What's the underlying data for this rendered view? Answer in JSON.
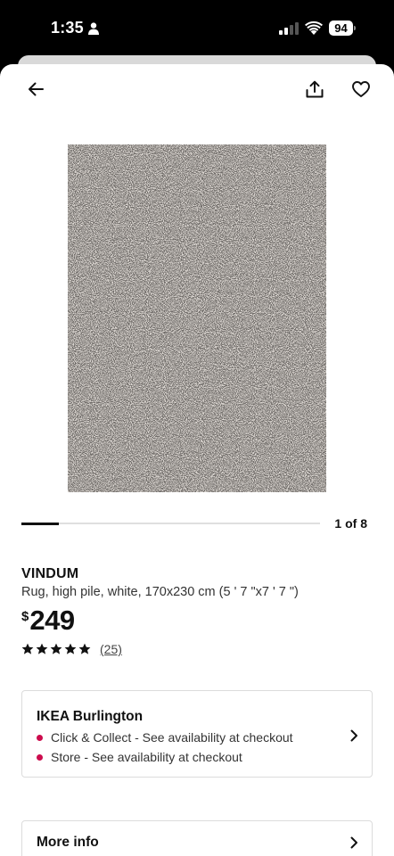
{
  "status_bar": {
    "time": "1:35",
    "battery": "94"
  },
  "header": {
    "back_icon": "arrow-left-icon",
    "share_icon": "share-icon",
    "favorite_icon": "heart-icon"
  },
  "gallery": {
    "current": 1,
    "total": 8,
    "counter": "1 of 8"
  },
  "product": {
    "name": "VINDUM",
    "description": "Rug, high pile, white, 170x230 cm (5 ' 7 \"x7 ' 7 \")",
    "currency": "$",
    "price": "249",
    "rating": 5,
    "reviews": "(25)"
  },
  "store": {
    "name": "IKEA Burlington",
    "availability": [
      "Click & Collect - See availability at checkout",
      "Store - See availability at checkout"
    ]
  },
  "more_info": {
    "label": "More info"
  },
  "colors": {
    "accent": "#cc0c4d",
    "text": "#111111",
    "border": "#dcdcdc"
  }
}
